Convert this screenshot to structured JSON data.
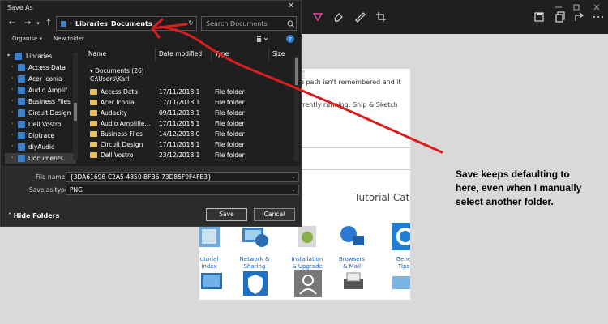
{
  "dialog": {
    "title": "Save As",
    "close_glyph": "✕",
    "nav": {
      "back": "←",
      "forward": "→",
      "up": "↑"
    },
    "breadcrumb": [
      "Libraries",
      "Documents"
    ],
    "search_placeholder": "Search Documents",
    "commands": {
      "organise": "Organise ▾",
      "new_folder": "New folder"
    },
    "nav_items": [
      {
        "label": "Libraries",
        "selected": false
      },
      {
        "label": "Access Data",
        "selected": false
      },
      {
        "label": "Acer Iconia",
        "selected": false
      },
      {
        "label": "Audio Amplif",
        "selected": false
      },
      {
        "label": "Business Files",
        "selected": false
      },
      {
        "label": "Circuit Design",
        "selected": false
      },
      {
        "label": "Dell Vostro",
        "selected": false
      },
      {
        "label": "Diptrace",
        "selected": false
      },
      {
        "label": "diyAudio",
        "selected": false
      },
      {
        "label": "Documents",
        "selected": true
      }
    ],
    "columns": {
      "name": "Name",
      "date": "Date modified",
      "type": "Type",
      "size": "Size"
    },
    "group_header": "Documents (26)",
    "group_path": "C:\\Users\\Karl",
    "files": [
      {
        "name": "Access Data",
        "date": "17/11/2018 1",
        "type": "File folder"
      },
      {
        "name": "Acer Iconia",
        "date": "17/11/2018 1",
        "type": "File folder"
      },
      {
        "name": "Audacity",
        "date": "09/11/2018 1",
        "type": "File folder"
      },
      {
        "name": "Audio Amplifie...",
        "date": "17/11/2018 1",
        "type": "File folder"
      },
      {
        "name": "Business Files",
        "date": "14/12/2018 0",
        "type": "File folder"
      },
      {
        "name": "Circuit Design",
        "date": "17/11/2018 1",
        "type": "File folder"
      },
      {
        "name": "Dell Vostro",
        "date": "23/12/2018 1",
        "type": "File folder"
      }
    ],
    "file_name_label": "File name:",
    "file_name_value": "{3DA61698-C2A5-4850-BFB6-73D85F9F4FE3}",
    "save_type_label": "Save as type:",
    "save_type_value": "PNG",
    "hide_folders": "Hide Folders",
    "save_button": "Save",
    "cancel_button": "Cancel"
  },
  "background": {
    "line1": "e path isn't remembered and it",
    "line2": "rrently running: Snip & Sketch",
    "tutorial_title": "Tutorial Cat",
    "tutorial_items": [
      {
        "label": "utorial\nIndex",
        "icon": "tutorial-index-icon"
      },
      {
        "label": "Network &\nSharing",
        "icon": "network-sharing-icon"
      },
      {
        "label": "Installation\n& Upgrade",
        "icon": "installation-icon"
      },
      {
        "label": "Browsers\n& Mail",
        "icon": "browsers-mail-icon"
      },
      {
        "label": "Gene\nTips",
        "icon": "general-tips-icon"
      }
    ]
  },
  "annotation": "Save keeps defaulting to here, even when I manually select another folder.",
  "colors": {
    "accent": "#d81e1e",
    "folder": "#e8c15a",
    "dialog_bg": "#1f1f1f"
  }
}
